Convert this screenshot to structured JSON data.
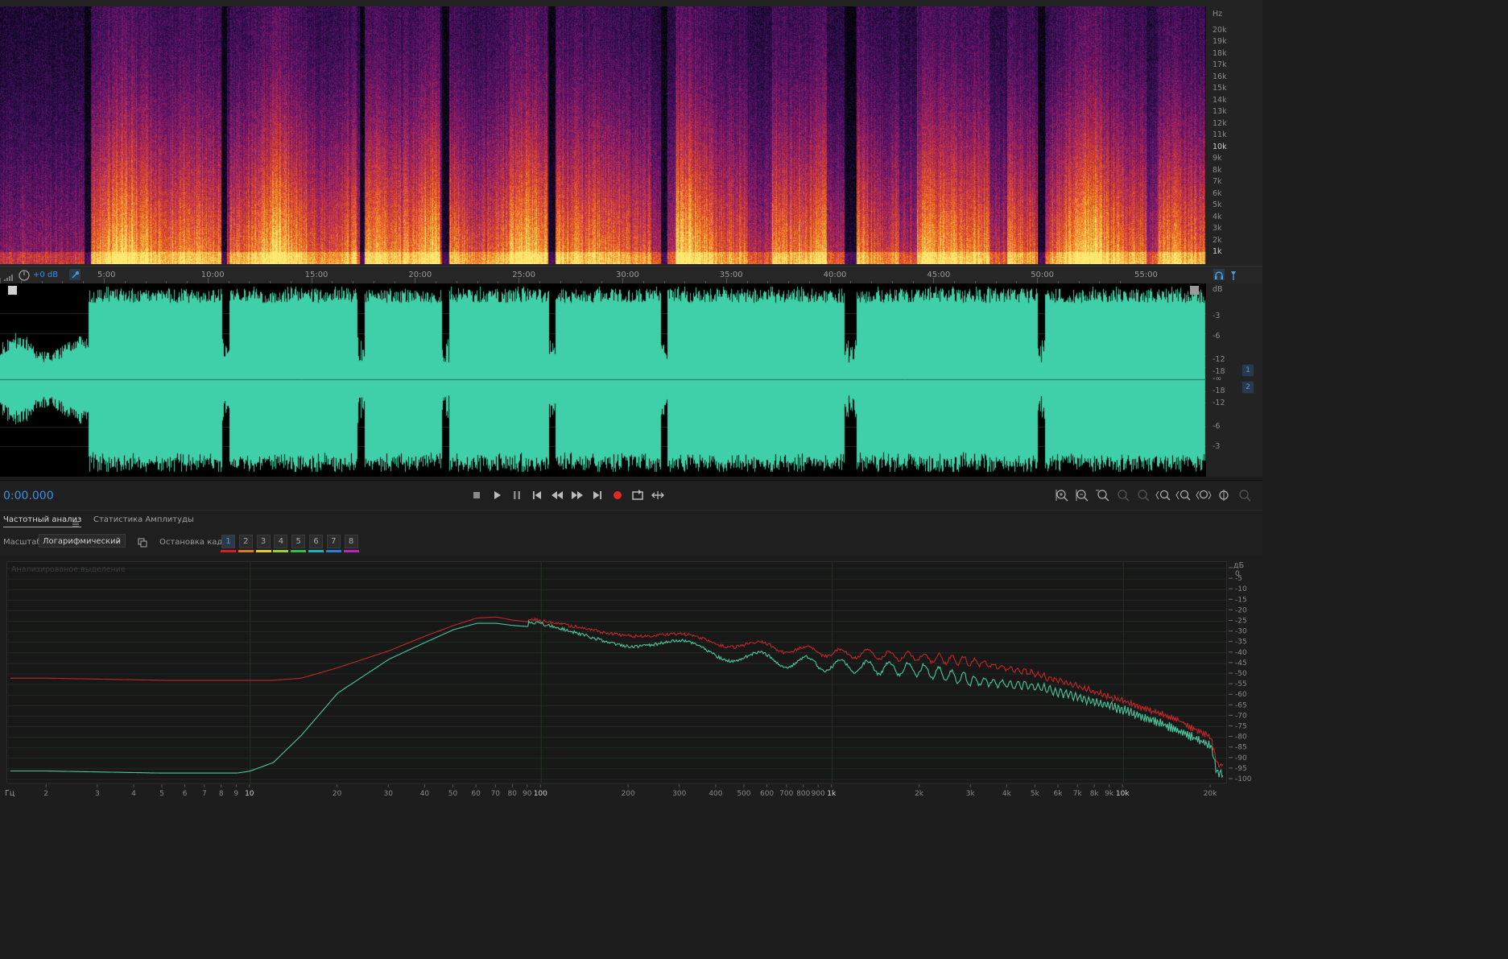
{
  "spectrogram_panel": {
    "hz_unit": "Hz",
    "hz_labels": [
      "20k",
      "19k",
      "18k",
      "17k",
      "16k",
      "15k",
      "14k",
      "13k",
      "12k",
      "11k",
      "10k",
      "9k",
      "8k",
      "7k",
      "6k",
      "5k",
      "4k",
      "3k",
      "2k",
      "1k"
    ],
    "colormap": [
      "#000000",
      "#200b3f",
      "#5a126a",
      "#a5245c",
      "#e04a2a",
      "#f89a2a",
      "#fde872"
    ]
  },
  "time_ruler": {
    "gain_label": "+0 dB",
    "time_labels": [
      "5:00",
      "10:00",
      "15:00",
      "20:00",
      "25:00",
      "30:00",
      "35:00",
      "40:00",
      "45:00",
      "50:00",
      "55:00"
    ]
  },
  "waveform_panel": {
    "db_unit": "dB",
    "db_labels_top": [
      "-3",
      "-6",
      "-12",
      "-18"
    ],
    "center_label": "-∞",
    "db_labels_bottom": [
      "-18",
      "-12",
      "-6",
      "-3"
    ],
    "channels": [
      "1",
      "2"
    ],
    "wave_color": "#3fd0aa"
  },
  "transport": {
    "time": "0:00.000",
    "buttons": [
      "stop",
      "play",
      "pause",
      "prev",
      "rewind",
      "forward",
      "next",
      "record",
      "loop",
      "skip"
    ]
  },
  "tabs": {
    "frequency_analysis": "Частотный анализ",
    "amplitude_stats": "Статистика Амплитуды"
  },
  "controls": {
    "scale_label": "Масштаб:",
    "scale_value": "Логарифмический",
    "hold_label": "Остановка кадра:",
    "frames": [
      "1",
      "2",
      "3",
      "4",
      "5",
      "6",
      "7",
      "8"
    ],
    "frame_colors": [
      "#d42020",
      "#e07a20",
      "#e0d020",
      "#a0d020",
      "#30c040",
      "#20b0c0",
      "#2080e0",
      "#c020c0"
    ]
  },
  "analysis": {
    "overlay_text": "Анализированое выделение",
    "db_unit": "дБ",
    "db_labels": [
      "0",
      "-5",
      "-10",
      "-15",
      "-20",
      "-25",
      "-30",
      "-35",
      "-40",
      "-45",
      "-50",
      "-55",
      "-60",
      "-65",
      "-70",
      "-75",
      "-80",
      "-85",
      "-90",
      "-95",
      "-100"
    ],
    "freq_unit": "Гц",
    "freq_labels": [
      "2",
      "3",
      "4",
      "5",
      "6",
      "7",
      "8",
      "9",
      "10",
      "20",
      "30",
      "40",
      "50",
      "60",
      "70",
      "80",
      "90",
      "100",
      "200",
      "300",
      "400",
      "500",
      "600",
      "700",
      "800",
      "900",
      "1k",
      "2k",
      "3k",
      "4k",
      "5k",
      "6k",
      "7k",
      "8k",
      "9k",
      "10k",
      "20k"
    ],
    "series_colors": [
      "#c02828",
      "#48c89c"
    ]
  },
  "chart_data": {
    "type": "line",
    "xlabel": "Гц",
    "ylabel": "дБ",
    "xscale": "log",
    "xlim": [
      1.5,
      22000
    ],
    "ylim": [
      -100,
      0
    ],
    "grid": true,
    "x": [
      1.5,
      2,
      5,
      9,
      10,
      12,
      15,
      20,
      30,
      40,
      50,
      60,
      70,
      80,
      100,
      150,
      200,
      300,
      500,
      700,
      1000,
      2000,
      3000,
      5000,
      7000,
      10000,
      15000,
      20000,
      21000
    ],
    "series": [
      {
        "values": [
          -52,
          -52,
          -53,
          -53,
          -53,
          -53,
          -52,
          -47,
          -39,
          -32,
          -27,
          -23.5,
          -23,
          -24.5,
          -26,
          -28,
          -30,
          -33,
          -36,
          -38,
          -40,
          -42,
          -44,
          -50,
          -56,
          -63,
          -71,
          -80,
          -93
        ]
      },
      {
        "values": [
          -96,
          -96,
          -97,
          -97,
          -96,
          -92,
          -79,
          -59,
          -43,
          -35,
          -29,
          -26,
          -26,
          -27,
          -28,
          -31,
          -34,
          -37,
          -42,
          -44,
          -46,
          -48,
          -53,
          -56,
          -61,
          -67,
          -76,
          -84,
          -97
        ]
      }
    ]
  }
}
